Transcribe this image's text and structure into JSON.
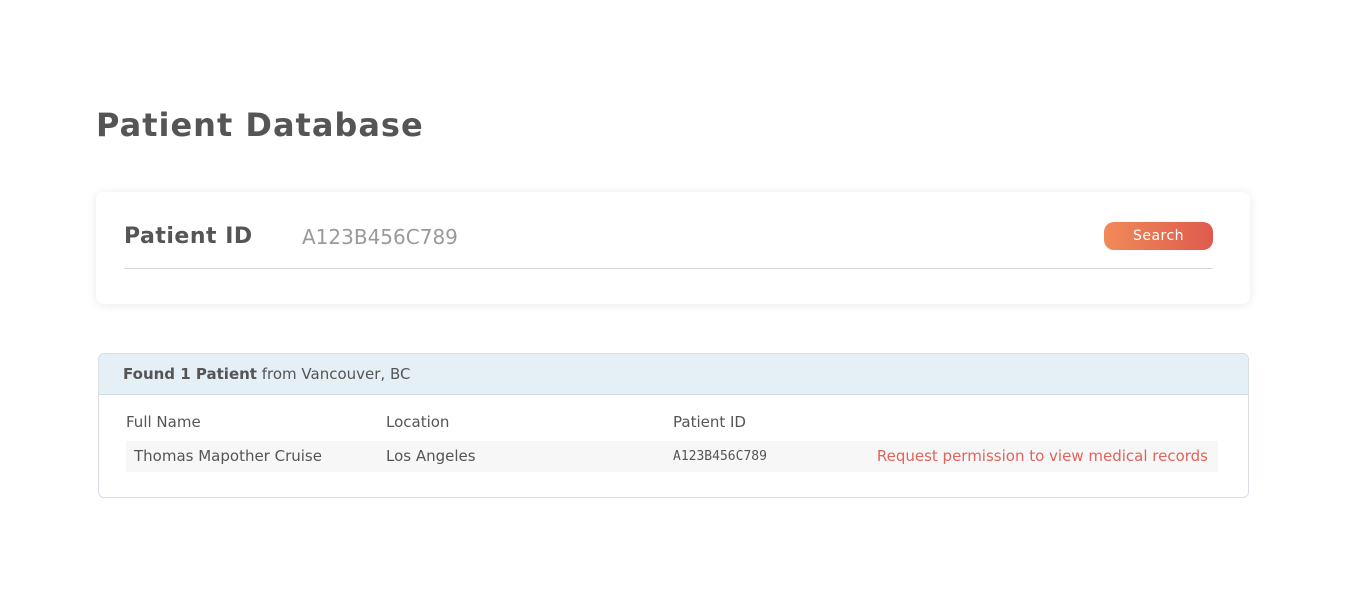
{
  "page": {
    "title": "Patient Database"
  },
  "search": {
    "label": "Patient ID",
    "value": "A123B456C789",
    "button_label": "Search"
  },
  "results": {
    "count_text": "Found 1 Patient",
    "location_text": "from Vancouver, BC",
    "columns": [
      "Full Name",
      "Location",
      "Patient ID"
    ],
    "rows": [
      {
        "full_name": "Thomas Mapother Cruise",
        "location": "Los Angeles",
        "patient_id": "A123B456C789",
        "action_label": "Request permission to view medical records"
      }
    ]
  },
  "colors": {
    "accent": "#e0645a",
    "button_gradient_start": "#f08a58",
    "button_gradient_end": "#df5a4e",
    "header_bg": "#e4eff6"
  }
}
